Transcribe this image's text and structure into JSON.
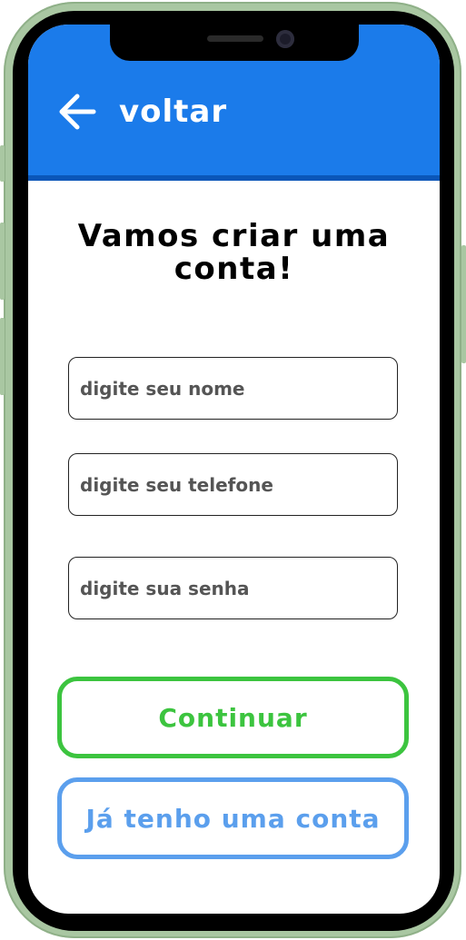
{
  "header": {
    "back_label": "voltar",
    "background_color": "#1b7bea",
    "back_icon": "arrow-left-icon"
  },
  "form": {
    "title_line1": "Vamos criar uma",
    "title_line2": "conta!",
    "name_placeholder": "digite seu nome",
    "phone_placeholder": "digite seu telefone",
    "password_placeholder": "digite sua senha"
  },
  "actions": {
    "continue_label": "Continuar",
    "continue_color": "#3cc43f",
    "have_account_label": "Já tenho uma conta",
    "have_account_color": "#5b9fed"
  },
  "device": {
    "frame_color": "#a9c7a2"
  }
}
